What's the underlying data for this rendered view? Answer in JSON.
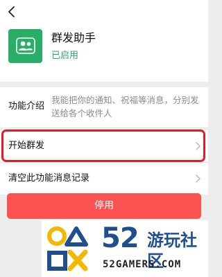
{
  "header": {
    "back_icon": "chevron-left-icon",
    "app_icon": "group-users-icon",
    "app_name": "群发助手",
    "status": "已启用",
    "colors": {
      "accent": "#2aae67"
    }
  },
  "intro": {
    "label": "功能介绍",
    "text": "我能把你的通知、祝福等消息，分别发送给各个收件人"
  },
  "actions": [
    {
      "label": "开始群发",
      "icon": "chevron-right-icon",
      "highlighted": true
    },
    {
      "label": "清空此功能消息记录",
      "icon": "chevron-right-icon"
    }
  ],
  "disable_button": {
    "label": "停用",
    "color": "#fa5151"
  },
  "watermark": {
    "number": "52",
    "site_name": "游玩社区",
    "url": "52GAMERS.COM",
    "highlight_color": "#e51b23"
  }
}
